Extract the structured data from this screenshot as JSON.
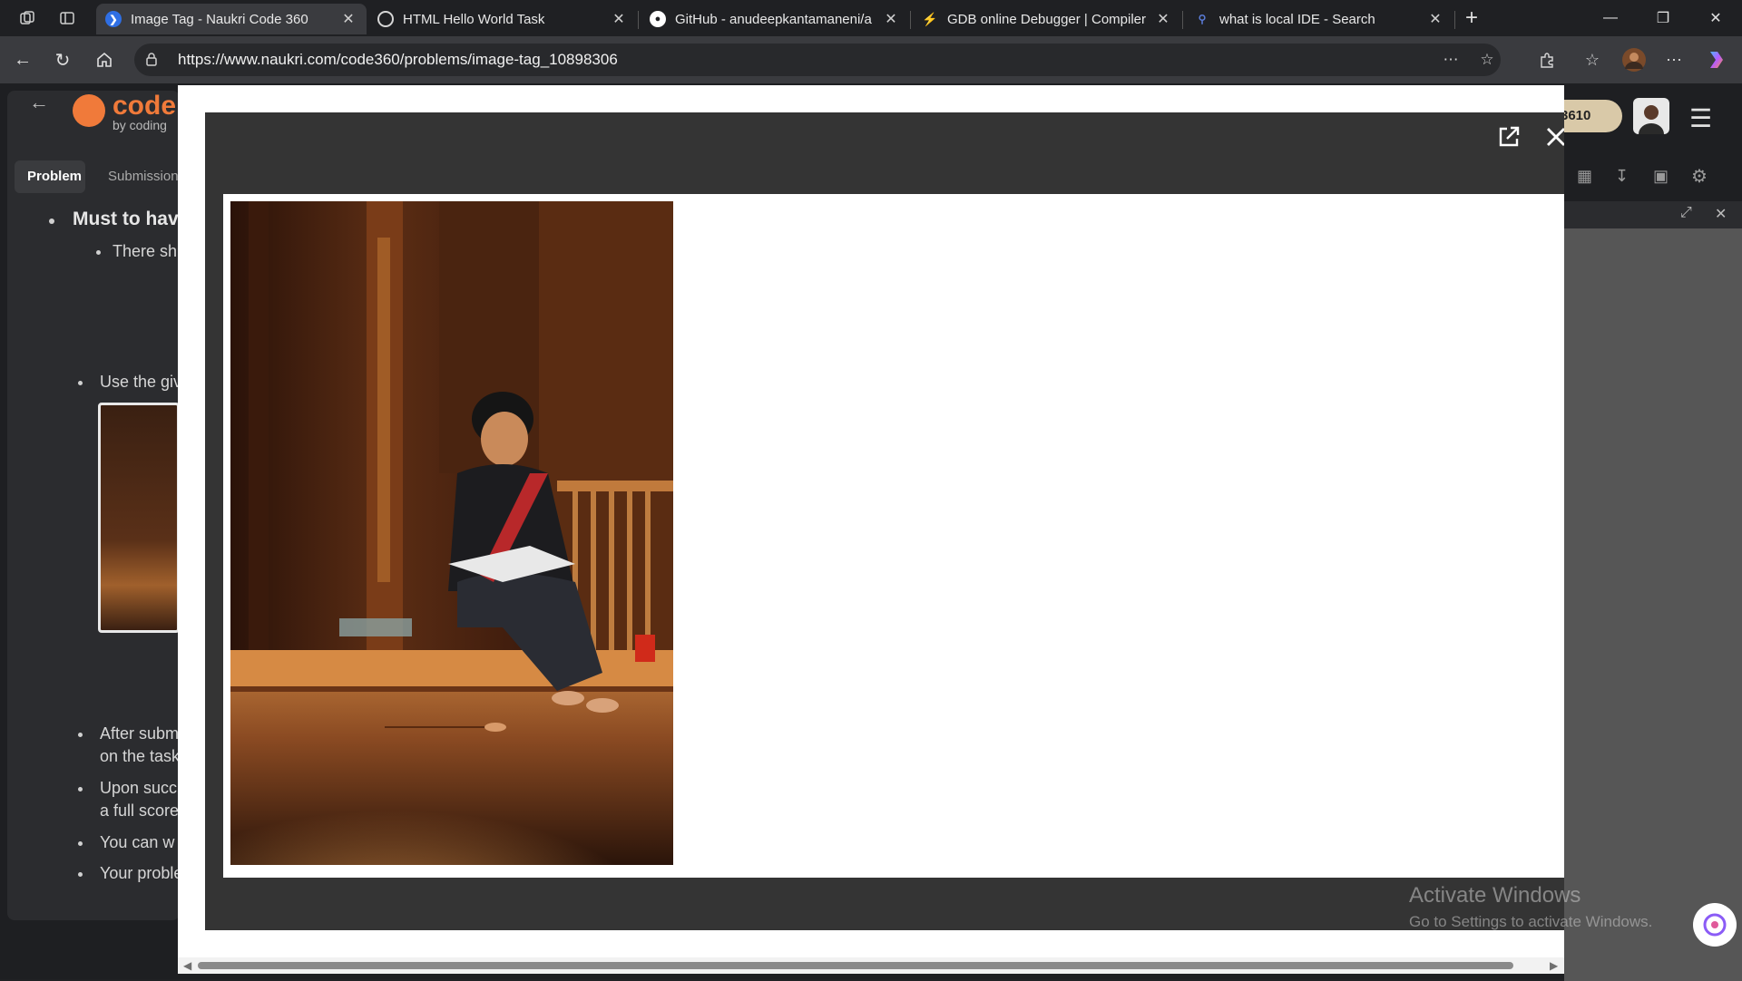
{
  "browser": {
    "tabs": [
      {
        "title": "Image Tag - Naukri Code 360",
        "active": true,
        "favicon_color": "#2f6fe4"
      },
      {
        "title": "HTML Hello World Task",
        "active": false,
        "favicon_color": "#d6d6d6"
      },
      {
        "title": "GitHub - anudeepkantamaneni/a",
        "active": false,
        "favicon_color": "#ffffff"
      },
      {
        "title": "GDB online Debugger | Compiler",
        "active": false,
        "favicon_color": "#8b5cf6"
      },
      {
        "title": "what is local IDE - Search",
        "active": false,
        "favicon_color": "#5a7bd6"
      }
    ],
    "url": "https://www.naukri.com/code360/problems/image-tag_10898306"
  },
  "page": {
    "logo_text": "code",
    "logo_sub": "by coding",
    "tabs": [
      "Problem",
      "Submission"
    ],
    "coins": "3610",
    "heading": "Must to hav",
    "lines": [
      "There sh",
      "Use the giv",
      "After subm",
      "on the task",
      "Upon succ",
      "a full score",
      "You can w",
      "Your proble"
    ]
  },
  "watermark": {
    "line1": "Activate Windows",
    "line2": "Go to Settings to activate Windows."
  },
  "colors": {
    "accent_orange": "#f07a3a",
    "modal_dark": "#343434"
  }
}
